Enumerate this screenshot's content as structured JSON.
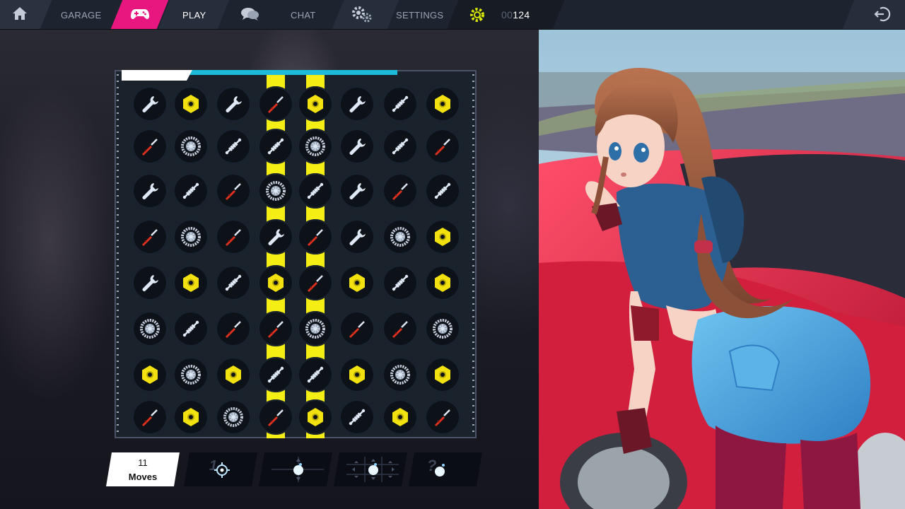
{
  "nav": {
    "home_label": "",
    "garage_label": "GARAGE",
    "play_label": "PLAY",
    "chat_label": "CHAT",
    "settings_label": "SETTINGS",
    "currency_dim": "00",
    "currency_value": "124",
    "icons": [
      "home-icon",
      "gamepad-icon",
      "chat-bubbles-icon",
      "gears-icon",
      "gear-coin-icon",
      "logout-icon"
    ],
    "colors": {
      "play_active": "#e8167f",
      "currency_icon": "#d6e600"
    }
  },
  "board": {
    "progress_fraction": 0.6,
    "highlight_columns": [
      3,
      4
    ],
    "grid": [
      [
        "wrench",
        "nut",
        "wrench",
        "screwdriver",
        "nut",
        "wrench",
        "spring",
        "nut"
      ],
      [
        "screwdriver",
        "wheel",
        "spring",
        "spring",
        "wheel",
        "wrench",
        "spring",
        "screwdriver"
      ],
      [
        "wrench",
        "spring",
        "screwdriver",
        "wheel",
        "spring",
        "wrench",
        "screwdriver",
        "spring"
      ],
      [
        "screwdriver",
        "wheel",
        "screwdriver",
        "wrench",
        "screwdriver",
        "wrench",
        "wheel",
        "nut"
      ],
      [
        "wrench",
        "nut",
        "spring",
        "nut",
        "screwdriver",
        "nut",
        "spring",
        "nut"
      ],
      [
        "wheel",
        "spring",
        "screwdriver",
        "screwdriver",
        "wheel",
        "screwdriver",
        "screwdriver",
        "wheel"
      ],
      [
        "nut",
        "wheel",
        "nut",
        "spring",
        "spring",
        "nut",
        "wheel",
        "nut"
      ],
      [
        "screwdriver",
        "nut",
        "wheel",
        "screwdriver",
        "nut",
        "spring",
        "nut",
        "screwdriver"
      ]
    ],
    "colors": {
      "stripe": "#f4ee14",
      "progress": "#1dbad9",
      "nut": "#f2e10f",
      "screwdriver_handle": "#e0301e"
    }
  },
  "footer": {
    "moves_count": "11",
    "moves_label": "Moves",
    "powerups": [
      {
        "name": "single-target-powerup",
        "label": "1"
      },
      {
        "name": "bomb-column-powerup",
        "label": ""
      },
      {
        "name": "bomb-area-powerup",
        "label": ""
      },
      {
        "name": "random-bomb-powerup",
        "label": "?"
      }
    ]
  }
}
